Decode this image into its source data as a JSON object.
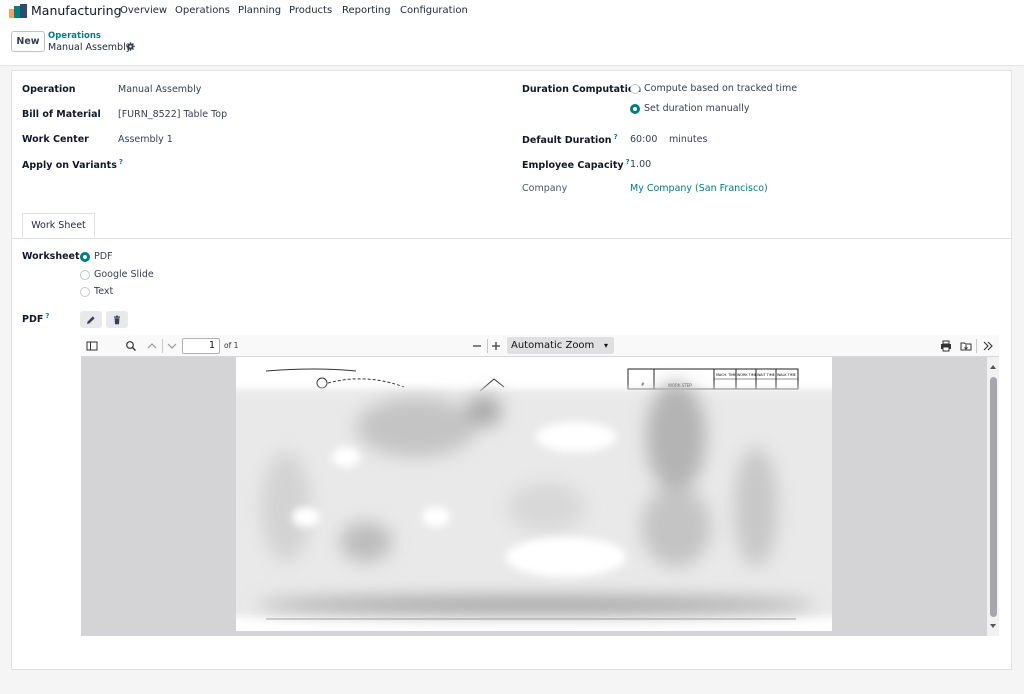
{
  "app": {
    "name": "Manufacturing"
  },
  "menu": [
    "Overview",
    "Operations",
    "Planning",
    "Products",
    "Reporting",
    "Configuration"
  ],
  "control": {
    "new_label": "New",
    "breadcrumb_parent": "Operations",
    "breadcrumb_current": "Manual Assembly"
  },
  "form": {
    "operation_label": "Operation",
    "operation_value": "Manual Assembly",
    "bom_label": "Bill of Material",
    "bom_value": "[FURN_8522] Table Top",
    "workcenter_label": "Work Center",
    "workcenter_value": "Assembly 1",
    "variants_label": "Apply on Variants",
    "duration_comp_label": "Duration Computation",
    "duration_options": [
      "Compute based on tracked time",
      "Set duration manually"
    ],
    "duration_selected": 1,
    "default_duration_label": "Default Duration",
    "default_duration_value": "60:00",
    "default_duration_unit": "minutes",
    "capacity_label": "Employee Capacity",
    "capacity_value": "1.00",
    "company_label": "Company",
    "company_value": "My Company (San Francisco)",
    "help_mark": "?"
  },
  "tabs": {
    "worksheet_tab": "Work Sheet"
  },
  "worksheet": {
    "label": "Worksheet",
    "options": [
      "PDF",
      "Google Slide",
      "Text"
    ],
    "selected": 0,
    "pdf_label": "PDF"
  },
  "pdf_viewer": {
    "page_number": "1",
    "page_count_label": "of 1",
    "zoom": "Automatic Zoom",
    "page_header_cells": [
      "WORK STEP",
      "MACH. TIME",
      "WORK TIME",
      "WAIT TIME",
      "WALK TIME",
      "#"
    ]
  },
  "colors": {
    "accent": "#017e84",
    "brand": "#e06b3b"
  }
}
